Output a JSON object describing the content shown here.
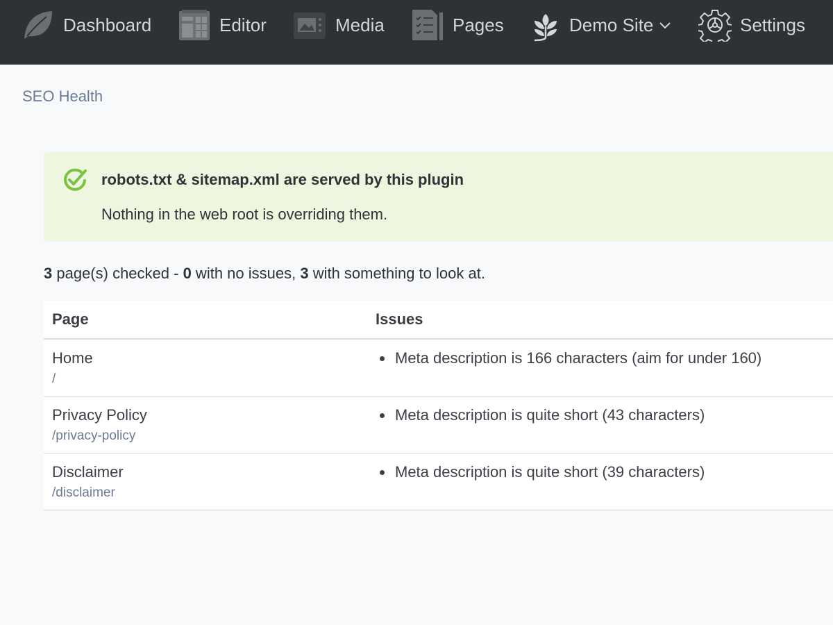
{
  "nav": {
    "items": [
      {
        "label": "Dashboard",
        "icon": "leaf-icon"
      },
      {
        "label": "Editor",
        "icon": "editor-layout-icon"
      },
      {
        "label": "Media",
        "icon": "image-icon"
      },
      {
        "label": "Pages",
        "icon": "pages-checklist-icon"
      },
      {
        "label": "Demo Site",
        "icon": "plant-sprout-icon",
        "has_dropdown": true
      },
      {
        "label": "Settings",
        "icon": "gear-icon"
      }
    ]
  },
  "breadcrumb": {
    "label": "SEO Health"
  },
  "alert": {
    "title": "robots.txt & sitemap.xml are served by this plugin",
    "text": "Nothing in the web root is overriding them.",
    "icon": "check-circle-icon",
    "color": "#7cc243"
  },
  "summary": {
    "checked": "3",
    "checked_text": " page(s) checked - ",
    "no_issues": "0",
    "no_issues_text": " with no issues, ",
    "with_issues": "3",
    "with_issues_text": " with something to look at."
  },
  "table": {
    "headers": {
      "page": "Page",
      "issues": "Issues"
    },
    "rows": [
      {
        "title": "Home",
        "path": "/",
        "issue": "Meta description is 166 characters (aim for under 160)"
      },
      {
        "title": "Privacy Policy",
        "path": "/privacy-policy",
        "issue": "Meta description is quite short (43 characters)"
      },
      {
        "title": "Disclaimer",
        "path": "/disclaimer",
        "issue": "Meta description is quite short (39 characters)"
      }
    ]
  }
}
